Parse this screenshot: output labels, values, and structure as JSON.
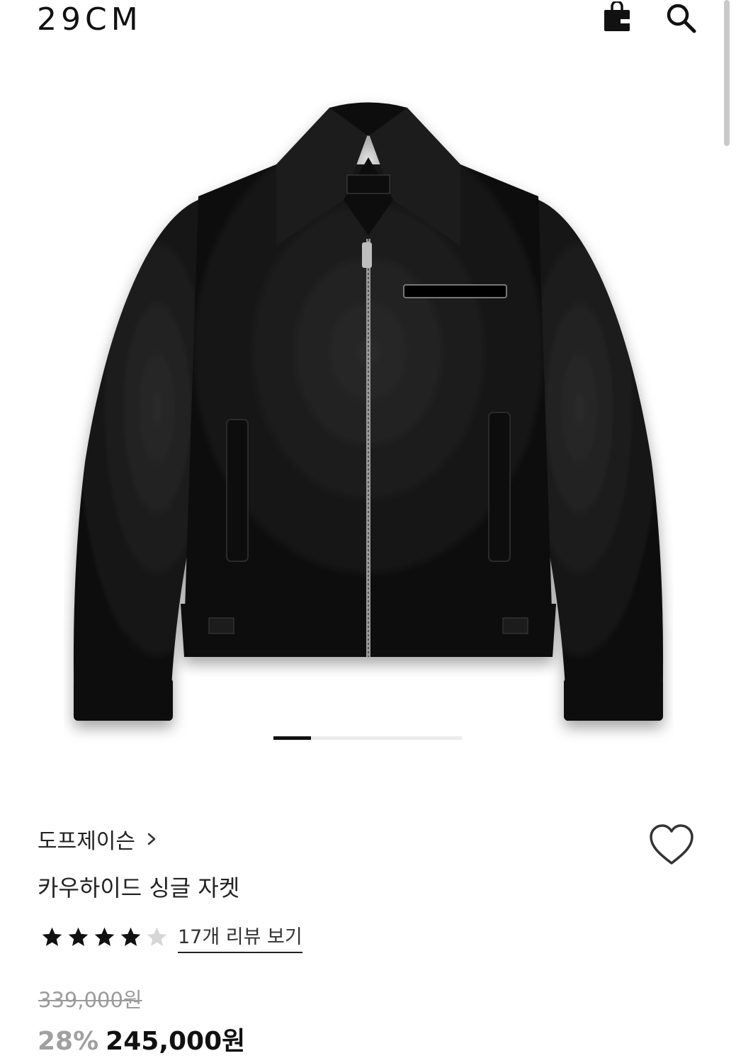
{
  "header": {
    "logo": "29CM",
    "icons": [
      "shopping-bag-icon",
      "search-icon"
    ]
  },
  "gallery": {
    "image": "black-leather-jacket",
    "current_slide_fraction": 0.2
  },
  "product": {
    "brand": "도프제이슨",
    "name": "카우하이드 싱글 자켓",
    "rating": 4,
    "rating_max": 5,
    "review_link": "17개 리뷰 보기",
    "original_price": "339,000원",
    "discount": "28%",
    "sale_price": "245,000원"
  },
  "colors": {
    "text": "#111111",
    "muted": "#9b9b9b",
    "star_filled": "#111111",
    "star_empty": "#d6d6d6"
  }
}
